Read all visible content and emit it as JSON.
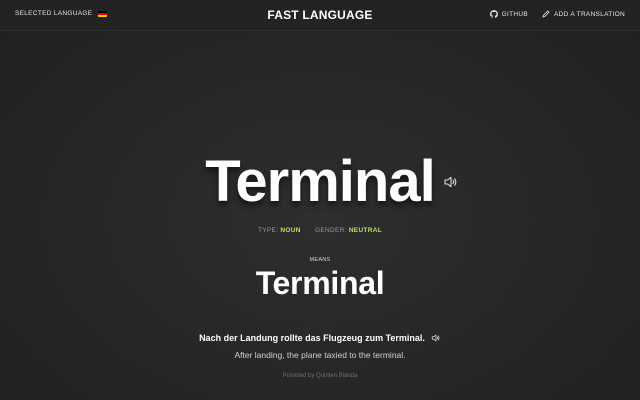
{
  "header": {
    "selected_language_label": "SELECTED LANGUAGE",
    "flag_icon": "germany-flag-icon",
    "flag_colors": [
      "#000000",
      "#dd0000",
      "#ffce00"
    ],
    "brand": "FAST LANGUAGE",
    "github_label": "GITHUB",
    "github_icon": "github-icon",
    "add_translation_label": "ADD A TRANSLATION",
    "add_translation_icon": "pencil-icon"
  },
  "word": {
    "text": "Terminal",
    "speaker_icon": "speaker-icon",
    "type_label": "TYPE:",
    "type_value": "NOUN",
    "gender_label": "GENDER:",
    "gender_value": "NEUTRAL",
    "accent_color": "#b6e26a"
  },
  "meaning": {
    "label": "MEANS",
    "text": "Terminal"
  },
  "example": {
    "sentence": "Nach der Landung rollte das Flugzeug zum Terminal.",
    "speaker_icon": "speaker-icon",
    "translation": "After landing, the plane taxied to the terminal."
  },
  "footer": {
    "credit": "Provided by Quinten Blanda"
  }
}
